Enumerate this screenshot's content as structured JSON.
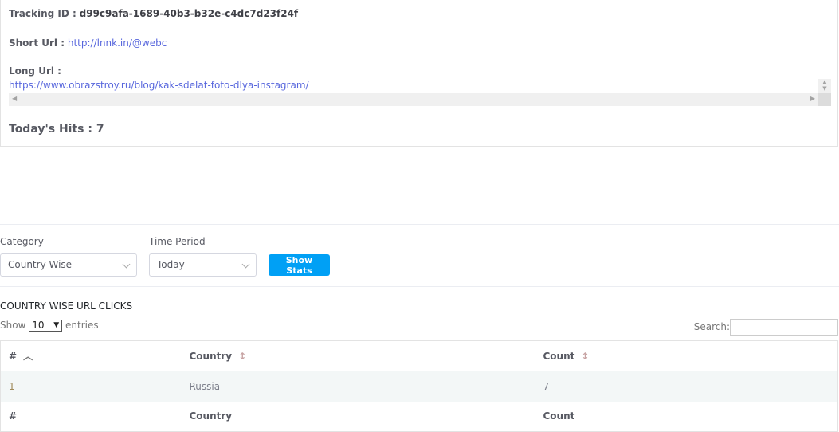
{
  "details": {
    "tracking_label": "Tracking ID :",
    "tracking_id": "d99c9afa-1689-40b3-b32e-c4dc7d23f24f",
    "short_label": "Short Url :",
    "short_url": "http://lnnk.in/@webc",
    "long_label": "Long Url :",
    "long_url": "https://www.obrazstroy.ru/blog/kak-sdelat-foto-dlya-instagram/",
    "hits_label": "Today's Hits : 7"
  },
  "filters": {
    "category_label": "Category",
    "category_value": "Country Wise",
    "period_label": "Time Period",
    "period_value": "Today",
    "show_button": "Show Stats"
  },
  "table": {
    "title": "COUNTRY WISE URL CLICKS",
    "show": "Show",
    "entries_value": "10",
    "entries": "entries",
    "search_label": "Search:",
    "headers": [
      "#",
      "Country",
      "Count"
    ],
    "rows": [
      [
        "1",
        "Russia",
        "7"
      ]
    ],
    "footers": [
      "#",
      "Country",
      "Count"
    ]
  }
}
